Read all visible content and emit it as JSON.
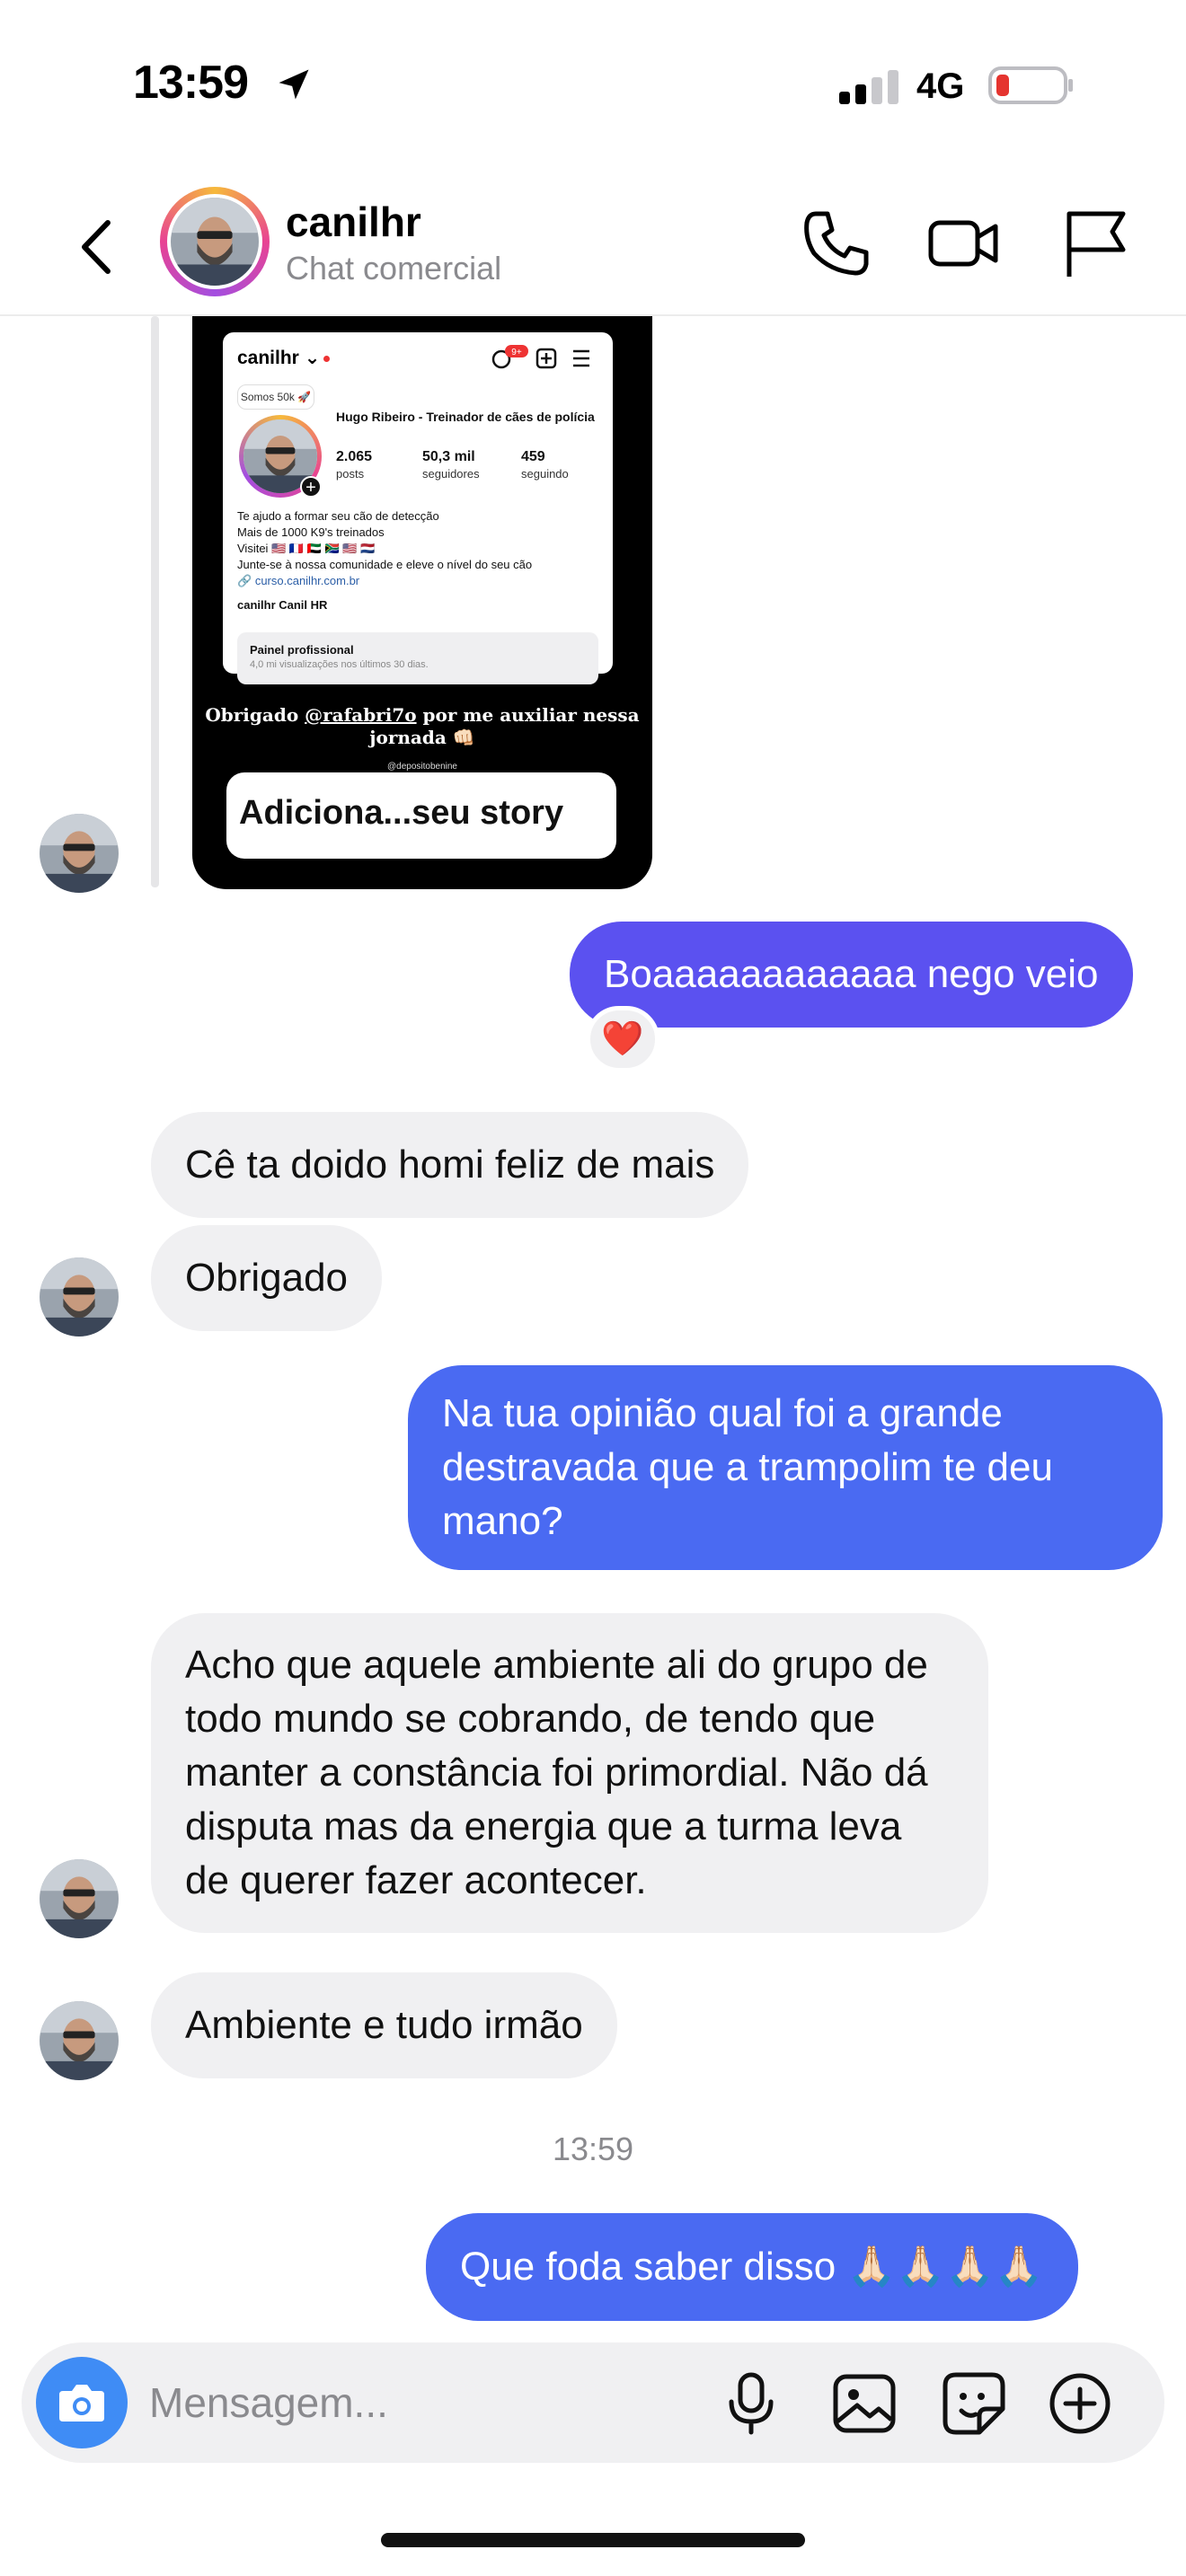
{
  "status_bar": {
    "time": "13:59",
    "network": "4G"
  },
  "header": {
    "name": "canilhr",
    "subtitle": "Chat comercial"
  },
  "story": {
    "profile": {
      "username": "canilhr",
      "badge_count": "9+",
      "note": "Somos 50k 🚀",
      "display_name": "Hugo Ribeiro - Treinador de cães de polícia",
      "stats": [
        {
          "value": "2.065",
          "label": "posts"
        },
        {
          "value": "50,3 mil",
          "label": "seguidores"
        },
        {
          "value": "459",
          "label": "seguindo"
        }
      ],
      "bio": [
        "Te ajudo a formar seu cão de detecção",
        "Mais de 1000 K9's treinados",
        "Visitei 🇺🇸 🇫🇷 🇦🇪 🇿🇦 🇺🇸 🇳🇱",
        "Junte-se à nossa comunidade e eleve o nível do seu cão"
      ],
      "link": "curso.canilhr.com.br",
      "tags": "canilhr   Canil HR",
      "panel_title": "Painel profissional",
      "panel_sub": "4,0 mi visualizações nos últimos 30 dias."
    },
    "caption_pre": "Obrigado ",
    "caption_mention": "@rafabri7o",
    "caption_post": " por me auxiliar nessa jornada 👊🏻",
    "handle": "@depositobenine",
    "button": "Adiciona...seu story"
  },
  "messages": {
    "m1": "Boaaaaaaaaaaaa nego veio",
    "reaction": "❤️",
    "m2": "Cê ta doido homi feliz de mais",
    "m3": "Obrigado",
    "m4": "Na tua opinião qual foi a grande destravada que a trampolim te deu mano?",
    "m5": "Acho que aquele ambiente ali do grupo de todo mundo se cobrando, de tendo que manter a constância foi primordial. Não dá disputa mas da energia que a turma leva de querer fazer acontecer.",
    "m6": "Ambiente e tudo irmão",
    "timestamp": "13:59",
    "m7": "Que foda saber disso 🙏🏻🙏🏻🙏🏻🙏🏻"
  },
  "composer": {
    "placeholder": "Mensagem..."
  },
  "colors": {
    "outgoing": "#5b51f0",
    "outgoing_alt": "#4a6af2",
    "incoming": "#f0f0f2",
    "camera": "#3f8cf5"
  }
}
